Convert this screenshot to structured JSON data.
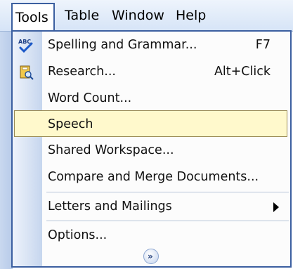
{
  "menubar": {
    "items": [
      {
        "label": "Tools"
      },
      {
        "label": "Table"
      },
      {
        "label": "Window"
      },
      {
        "label": "Help"
      }
    ]
  },
  "menu": {
    "items": [
      {
        "label": "Spelling and Grammar...",
        "shortcut": "F7",
        "icon": "spelling-abc-check-icon"
      },
      {
        "label": "Research...",
        "shortcut": "Alt+Click",
        "icon": "research-book-icon"
      },
      {
        "label": "Word Count..."
      },
      {
        "label": "Speech"
      },
      {
        "label": "Shared Workspace..."
      },
      {
        "label": "Compare and Merge Documents..."
      },
      {
        "label": "Letters and Mailings"
      },
      {
        "label": "Options..."
      }
    ],
    "expand_glyph": "»"
  },
  "colors": {
    "highlight": "#fff9cc",
    "border": "#3b5fa0"
  }
}
